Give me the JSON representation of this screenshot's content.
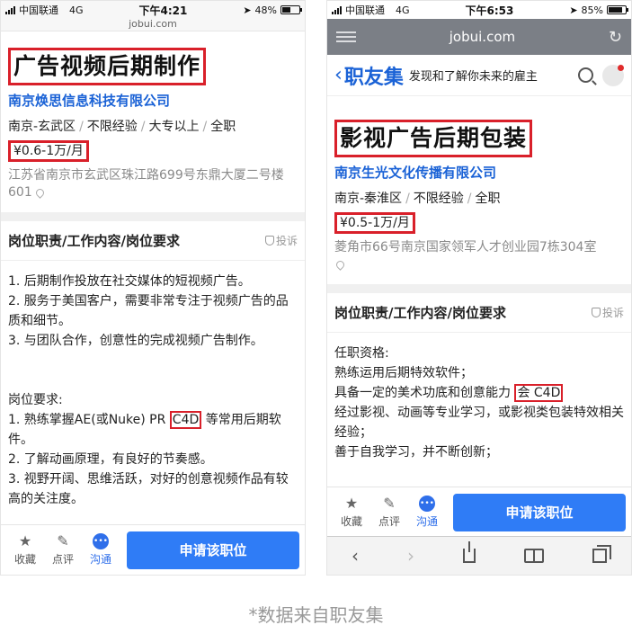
{
  "left": {
    "status": {
      "carrier": "中国联通",
      "network": "4G",
      "time": "下午4:21",
      "battery": "48%",
      "battery_level": 0.48
    },
    "url": "jobui.com",
    "job_title": "广告视频后期制作",
    "company": "南京焕思信息科技有限公司",
    "meta": {
      "location": "南京-玄武区",
      "experience": "不限经验",
      "education": "大专以上",
      "type": "全职"
    },
    "salary": "¥0.6-1万/月",
    "address": "江苏省南京市玄武区珠江路699号东鼎大厦二号楼601",
    "section_title": "岗位职责/工作内容/岗位要求",
    "report": "投诉",
    "duties": [
      "1. 后期制作投放在社交媒体的短视频广告。",
      "2. 服务于美国客户，需要非常专注于视频广告的品质和细节。",
      "3. 与团队合作，创意性的完成视频广告制作。"
    ],
    "req_heading": "岗位要求:",
    "req1_pre": "1. 熟练掌握AE(或Nuke) PR ",
    "req1_hl": "C4D",
    "req1_post": " 等常用后期软件。",
    "req2": "2. 了解动画原理，有良好的节奏感。",
    "req3": "3. 视野开阔、思维活跃，对好的创意视频作品有较高的关注度。",
    "bottom": {
      "favorite": "收藏",
      "review": "点评",
      "chat": "沟通",
      "apply": "申请该职位"
    }
  },
  "right": {
    "status": {
      "carrier": "中国联通",
      "network": "4G",
      "time": "下午6:53",
      "battery": "85%",
      "battery_level": 0.85
    },
    "url": "jobui.com",
    "site_logo": "职友集",
    "site_slogan": "发现和了解你未来的雇主",
    "job_title": "影视广告后期包装",
    "company": "南京生光文化传播有限公司",
    "meta": {
      "location": "南京-秦淮区",
      "experience": "不限经验",
      "type": "全职"
    },
    "salary": "¥0.5-1万/月",
    "address": "菱角市66号南京国家领军人才创业园7栋304室",
    "section_title": "岗位职责/工作内容/岗位要求",
    "report": "投诉",
    "qual_heading": "任职资格:",
    "q1": "熟练运用后期特效软件；",
    "q2_pre": "具备一定的美术功底和创意能力",
    "q2_hl": "会 C4D",
    "q3": "经过影视、动画等专业学习，或影视类包装特效相关经验；",
    "q4": "善于自我学习，并不断创新；",
    "bottom": {
      "favorite": "收藏",
      "review": "点评",
      "chat": "沟通",
      "apply": "申请该职位"
    }
  },
  "caption": "*数据来自职友集"
}
